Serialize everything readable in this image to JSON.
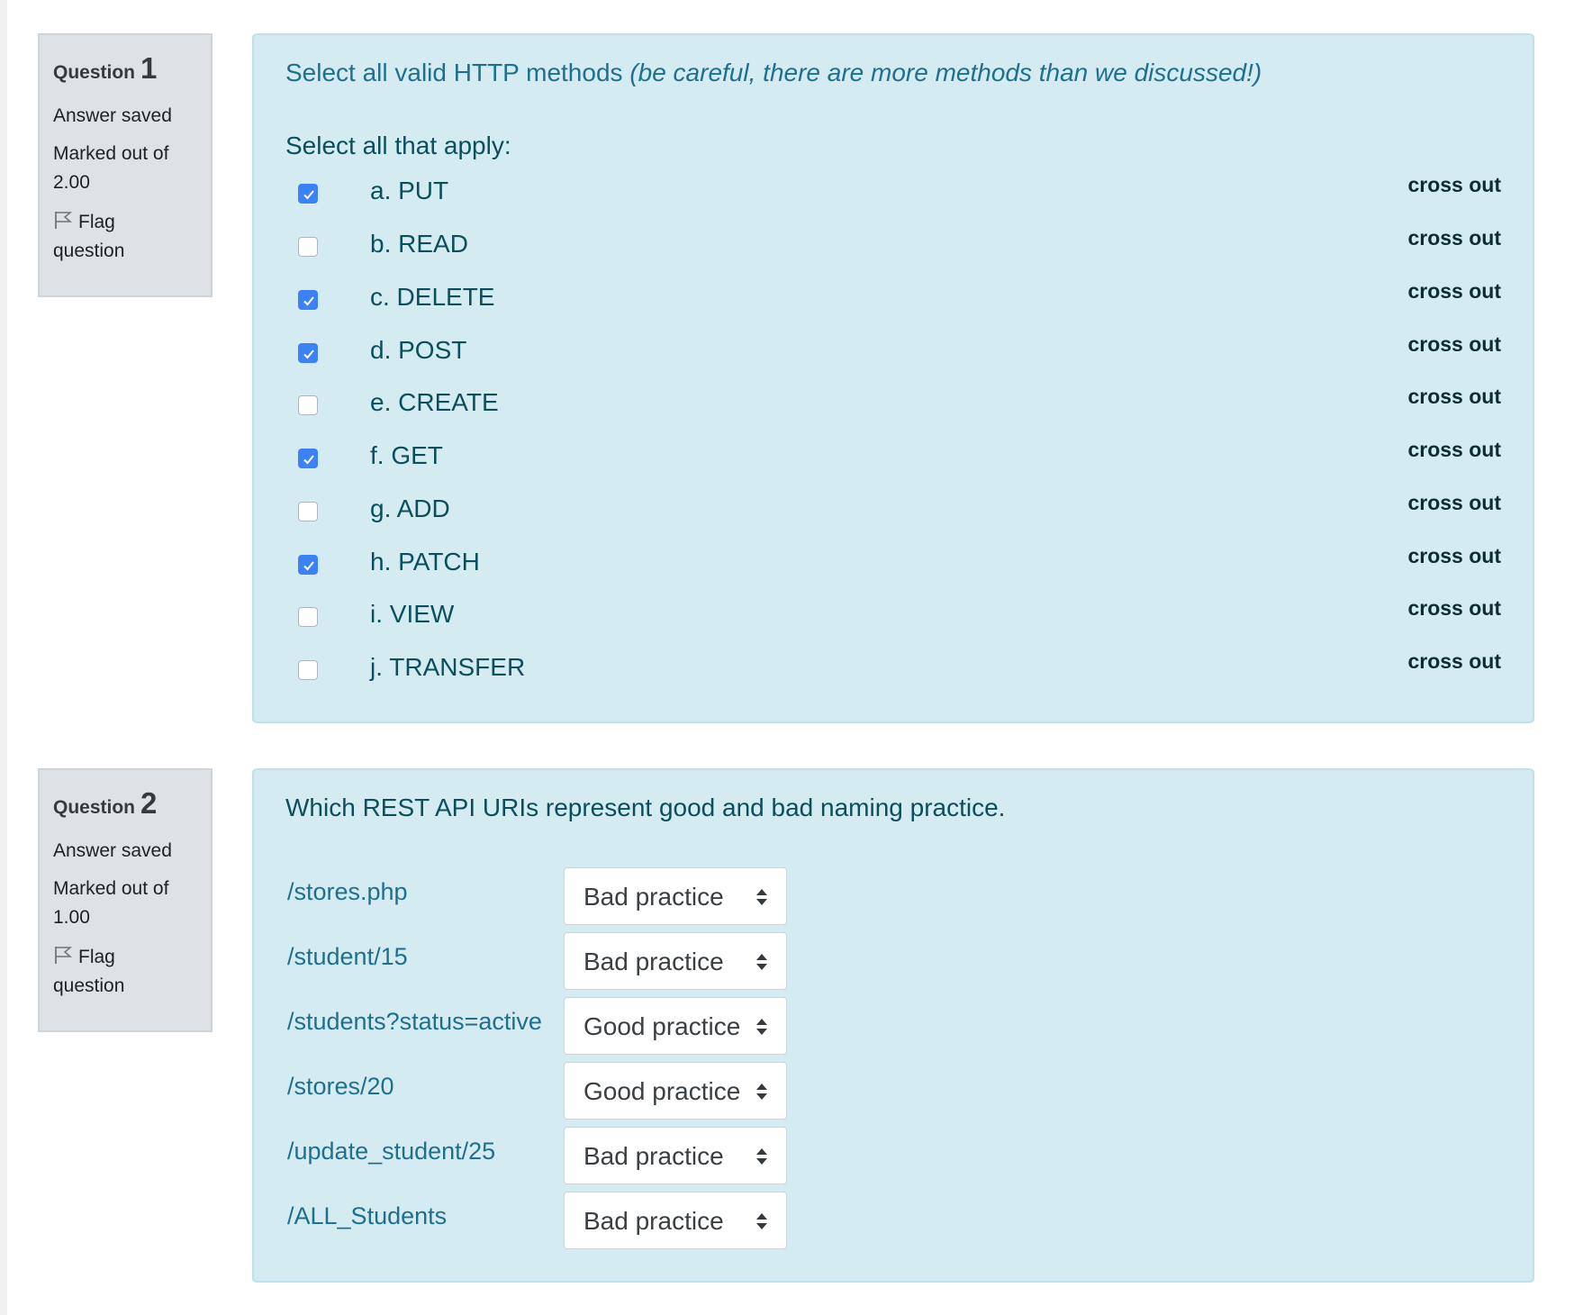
{
  "questions": [
    {
      "label": "Question",
      "number": "1",
      "state": "Answer saved",
      "grade": "Marked out of 2.00",
      "flag": "Flag question",
      "text_main": "Select all valid HTTP methods ",
      "text_emph": "(be careful, there are more methods than we discussed!)",
      "prompt": "Select all that apply:",
      "cross_out_label": "cross out",
      "options": [
        {
          "label": "a. PUT",
          "checked": true
        },
        {
          "label": "b. READ",
          "checked": false
        },
        {
          "label": "c. DELETE",
          "checked": true
        },
        {
          "label": "d. POST",
          "checked": true
        },
        {
          "label": "e. CREATE",
          "checked": false
        },
        {
          "label": "f. GET",
          "checked": true
        },
        {
          "label": "g. ADD",
          "checked": false
        },
        {
          "label": "h. PATCH",
          "checked": true
        },
        {
          "label": "i. VIEW",
          "checked": false
        },
        {
          "label": "j. TRANSFER",
          "checked": false
        }
      ]
    },
    {
      "label": "Question",
      "number": "2",
      "state": "Answer saved",
      "grade": "Marked out of 1.00",
      "flag": "Flag question",
      "text_main": "Which REST API URIs represent good and bad naming practice.",
      "rows": [
        {
          "uri": "/stores.php",
          "selected": "Bad practice"
        },
        {
          "uri": "/student/15",
          "selected": "Bad practice"
        },
        {
          "uri": "/students?status=active",
          "selected": "Good practice"
        },
        {
          "uri": "/stores/20",
          "selected": "Good practice"
        },
        {
          "uri": "/update_student/25",
          "selected": "Bad practice"
        },
        {
          "uri": "/ALL_Students",
          "selected": "Bad practice"
        }
      ]
    }
  ],
  "colors": {
    "content_bg": "#d4ebf2",
    "info_bg": "#dee2e6",
    "checkbox_on": "#3b82f6",
    "text_teal": "#1f6f8f"
  },
  "icons": {
    "flag": "flag-icon",
    "check": "checkmark-icon",
    "select_arrows": "sort-arrows-icon"
  }
}
